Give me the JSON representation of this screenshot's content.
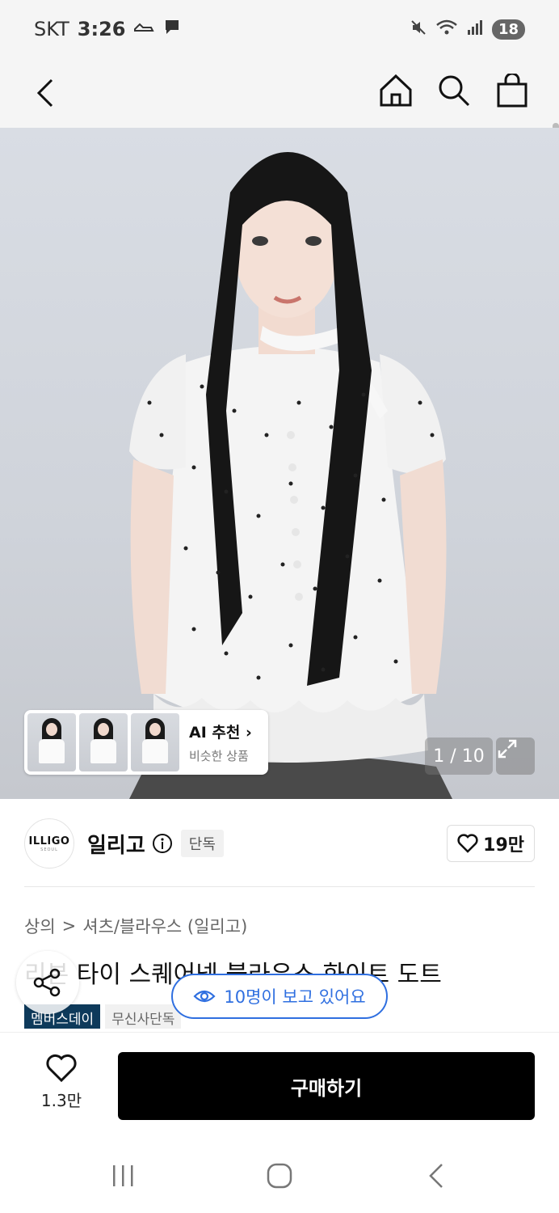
{
  "status_bar": {
    "carrier": "SKT",
    "time": "3:26",
    "battery": "18"
  },
  "top_nav": {
    "icons": [
      "back-icon",
      "home-icon",
      "search-icon",
      "shopping-bag-icon"
    ]
  },
  "hero": {
    "ai_recommend": {
      "title": "AI 추천",
      "subtitle": "비슷한 상품"
    },
    "pager": "1 / 10"
  },
  "brand": {
    "logo_text": "ILLIGO",
    "logo_sub": "SEOUL",
    "name": "일리고",
    "badge": "단독",
    "likes": "19만"
  },
  "breadcrumb": {
    "category": "상의",
    "separator": ">",
    "subcategory": "셔츠/블라우스 (일리고)"
  },
  "product": {
    "title": "리본 타이 스퀘어넥 블라우스 화이트 도트",
    "viewers": "10명이 보고 있어요",
    "tags": [
      "멤버스데이",
      "무신사단독"
    ]
  },
  "purchase": {
    "wish_count": "1.3만",
    "buy_label": "구매하기"
  },
  "colors": {
    "accent_blue": "#2f6fe0",
    "tag_navy": "#0e3a5b",
    "buy_black": "#000000"
  }
}
